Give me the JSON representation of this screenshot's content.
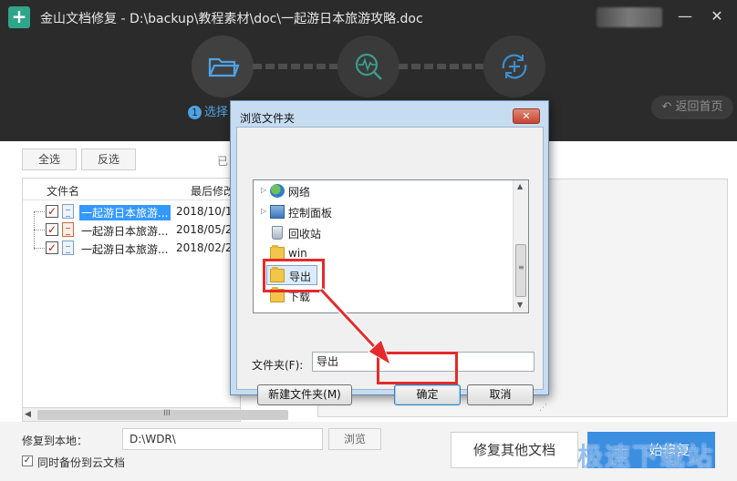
{
  "window": {
    "title": "金山文档修复 - D:\\backup\\教程素材\\doc\\一起游日本旅游攻略.doc",
    "minimize_glyph": "—",
    "close_glyph": "✕"
  },
  "steps": {
    "active_number": "1",
    "active_label": "选择"
  },
  "header": {
    "back_home_label": "返回首页"
  },
  "toolbar": {
    "select_all": "全选",
    "invert_select": "反选",
    "selected_prefix": "已"
  },
  "file_list": {
    "col_name": "文件名",
    "col_date": "最后修改",
    "rows": [
      {
        "name": "一起游日本旅游...",
        "date": "2018/10/1",
        "checked": true,
        "selected": true
      },
      {
        "name": "一起游日本旅游...",
        "date": "2018/05/2",
        "checked": true,
        "selected": false
      },
      {
        "name": "一起游日本旅游...",
        "date": "2018/02/2",
        "checked": true,
        "selected": false
      }
    ],
    "hscroll_grip": "III"
  },
  "bottom": {
    "restore_label": "修复到本地：",
    "restore_path": "D:\\WDR\\",
    "browse_label": "浏览",
    "backup_label": "同时备份到云文档",
    "repair_other_label": "修复其他文档",
    "start_repair_label": "始修复",
    "watermark": "极速下载站"
  },
  "dialog": {
    "title": "浏览文件夹",
    "close_glyph": "✕",
    "tree": [
      {
        "label": "网络",
        "icon": "network-icon",
        "expandable": true
      },
      {
        "label": "控制面板",
        "icon": "control-panel-icon",
        "expandable": true
      },
      {
        "label": "回收站",
        "icon": "recycle-bin-icon",
        "expandable": false
      },
      {
        "label": "win",
        "icon": "folder-icon",
        "expandable": false
      },
      {
        "label": "导出",
        "icon": "folder-icon",
        "expandable": false,
        "selected": true
      },
      {
        "label": "下载",
        "icon": "folder-icon",
        "expandable": false
      }
    ],
    "folder_label": "文件夹(F):",
    "folder_value": "导出",
    "new_folder_button": "新建文件夹(M)",
    "ok_button": "确定",
    "cancel_button": "取消"
  },
  "colors": {
    "header_bg": "#2b2b2b",
    "accent_blue": "#4ea3e6",
    "annotation_red": "#e52b2b",
    "start_repair_bg": "#3b8ee0"
  }
}
